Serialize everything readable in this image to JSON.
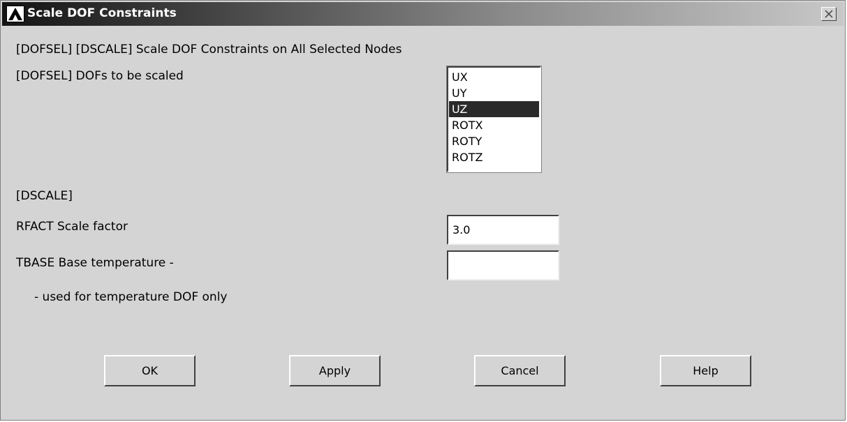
{
  "window": {
    "title": "Scale DOF Constraints"
  },
  "labels": {
    "header": "[DOFSEL] [DSCALE]  Scale DOF Constraints on All Selected Nodes",
    "dofs_label": "[DOFSEL]  DOFs to be scaled",
    "dscale_section": "[DSCALE]",
    "rfact_label": "RFACT  Scale factor",
    "tbase_label": "TBASE  Base temperature -",
    "tbase_note": "- used for temperature DOF only"
  },
  "dof_list": {
    "items": [
      "UX",
      "UY",
      "UZ",
      "ROTX",
      "ROTY",
      "ROTZ"
    ],
    "selected": "UZ"
  },
  "fields": {
    "rfact_value": "3.0",
    "tbase_value": ""
  },
  "buttons": {
    "ok": "OK",
    "apply": "Apply",
    "cancel": "Cancel",
    "help": "Help"
  },
  "icons": {
    "app": "ansys-logo-icon",
    "close": "close-icon"
  }
}
